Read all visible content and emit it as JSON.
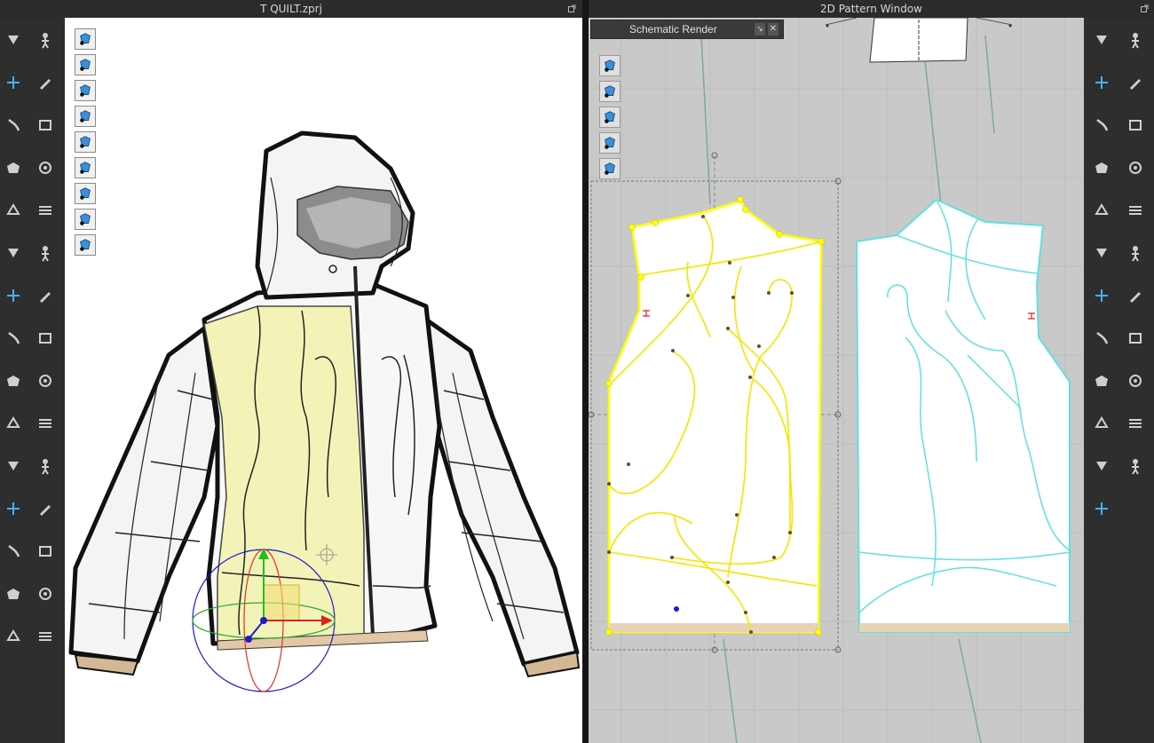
{
  "windows": {
    "left_title": "T QUILT.zprj",
    "right_title": "2D Pattern Window"
  },
  "schematic_panel": {
    "title": "Schematic Render"
  },
  "colors": {
    "viewport_bg": "#ffffff",
    "pattern_bg": "#c9c9c9",
    "selected_pattern": "#ffff00",
    "unselected_pattern": "#5fe0e0",
    "toolbar_bg": "#2e2e2e",
    "highlight_panel": "#f3f3b8"
  },
  "left_tools": [
    "simulation-icon",
    "avatar-pose-icon",
    "select-move-icon",
    "transform-pattern-icon",
    "brush-icon",
    "edit-pin-icon",
    "fold-icon",
    "tack-icon",
    "mannequin-icon",
    "pin-arrangement-icon",
    "arrangement-icon",
    "cloth-icon",
    "puckering-icon",
    "measure-icon",
    "flatten-icon",
    "fabric-icon",
    "graphic-icon",
    "button-icon",
    "buttonhole-icon",
    "zip-icon",
    "garment-icon",
    "layer-icon",
    "avatar-icon",
    "topstitch-icon",
    "texture-icon",
    "fitting-icon",
    "tape-icon",
    "size-icon",
    "ruler-icon",
    "snap-icon"
  ],
  "viewport_tools": [
    "avatar-render-icon",
    "garment-render-icon",
    "show-garment-icon",
    "show-pins-icon",
    "show-avatar-icon",
    "show-fabric-icon",
    "show-shadow-icon",
    "x-ray-icon",
    "wire-frame-icon"
  ],
  "pattern_view_tools": [
    "show-pattern-icon",
    "show-garment-2d-icon",
    "show-info-icon",
    "show-fabric-2d-icon",
    "lock-icon"
  ],
  "right_tools": [
    "select-pattern-icon",
    "edit-curve-icon",
    "polygon-icon",
    "rectangle-icon",
    "circle-icon",
    "internal-shape-icon",
    "dart-icon",
    "notch-icon",
    "seam-icon",
    "free-seam-icon",
    "segment-sewing-icon",
    "trace-icon",
    "check-sewing-icon",
    "overlap-icon",
    "edit-sewing-icon",
    "text-icon",
    "annotation-icon",
    "grading-icon",
    "mirror-icon",
    "pleat-icon",
    "elastic-icon",
    "fold-arrange-icon",
    "quilt-icon"
  ]
}
